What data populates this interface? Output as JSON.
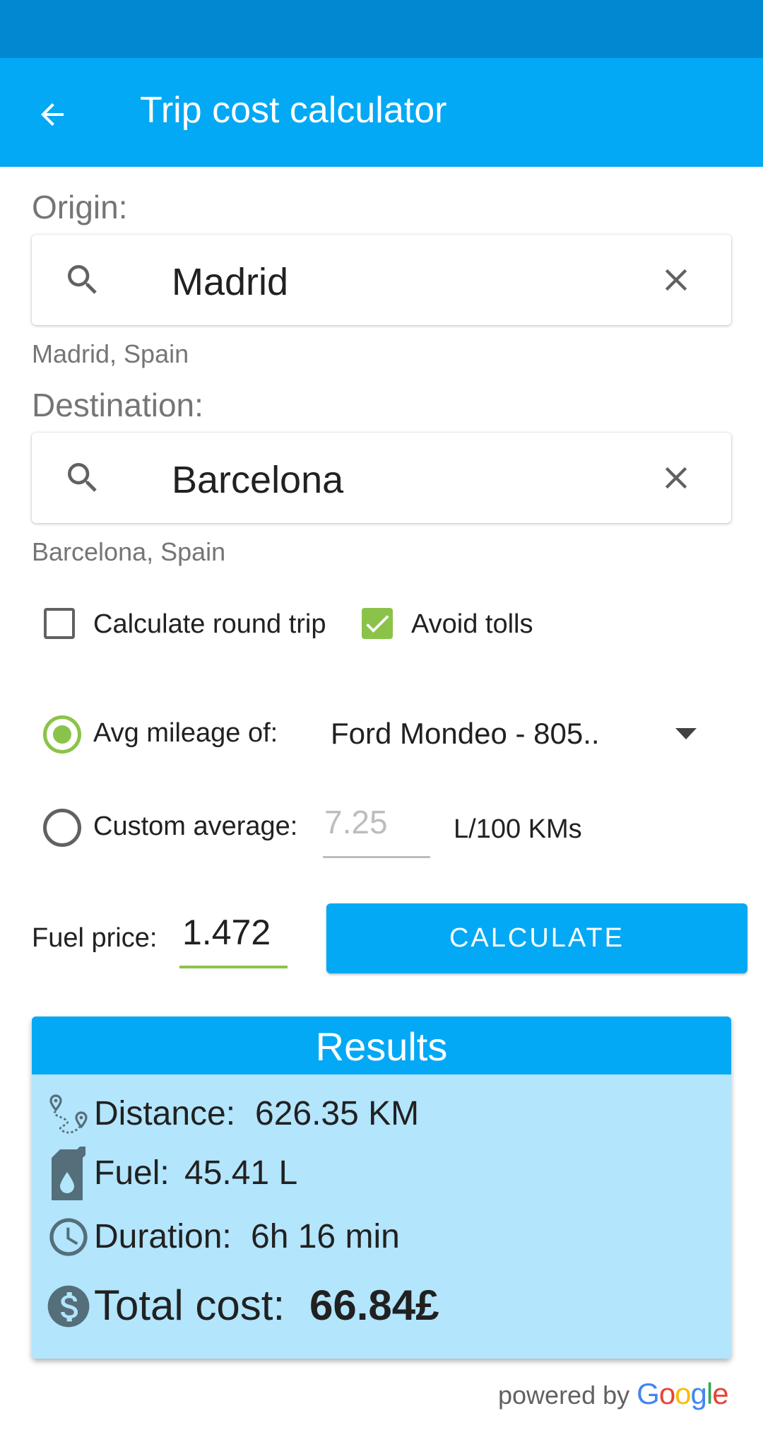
{
  "app_bar": {
    "title": "Trip cost calculator"
  },
  "origin": {
    "label": "Origin:",
    "value": "Madrid",
    "resolved": "Madrid, Spain"
  },
  "destination": {
    "label": "Destination:",
    "value": "Barcelona",
    "resolved": "Barcelona, Spain"
  },
  "options": {
    "round_trip_label": "Calculate round trip",
    "round_trip_checked": false,
    "avoid_tolls_label": "Avoid tolls",
    "avoid_tolls_checked": true
  },
  "mileage": {
    "avg_label": "Avg mileage of:",
    "avg_selected": true,
    "vehicle_selected": "Ford Mondeo - 805..",
    "custom_label": "Custom average:",
    "custom_placeholder": "7.25",
    "unit": "L/100 KMs"
  },
  "fuel": {
    "label": "Fuel price:",
    "value": "1.472"
  },
  "calculate_label": "CALCULATE",
  "results": {
    "title": "Results",
    "distance_label": "Distance:",
    "distance_value": "626.35 KM",
    "fuel_label": "Fuel:",
    "fuel_value": "45.41 L",
    "duration_label": "Duration:",
    "duration_value": "6h 16 min",
    "total_label": "Total cost:",
    "total_value": "66.84£"
  },
  "footer": {
    "powered_by": "powered by",
    "brand_letters": [
      "G",
      "o",
      "o",
      "g",
      "l",
      "e"
    ],
    "brand_colors": [
      "#4285F4",
      "#EA4335",
      "#FBBC05",
      "#4285F4",
      "#34A853",
      "#EA4335"
    ]
  },
  "colors": {
    "status_bar": "#0288d1",
    "app_bar": "#03a9f4",
    "accent_green": "#8bc34a",
    "results_bg": "#b3e5fc"
  },
  "icons": [
    "back-arrow-icon",
    "search-icon",
    "close-icon",
    "checkbox-icon",
    "dropdown-arrow-icon",
    "route-icon",
    "fuel-can-icon",
    "clock-icon",
    "dollar-icon"
  ]
}
